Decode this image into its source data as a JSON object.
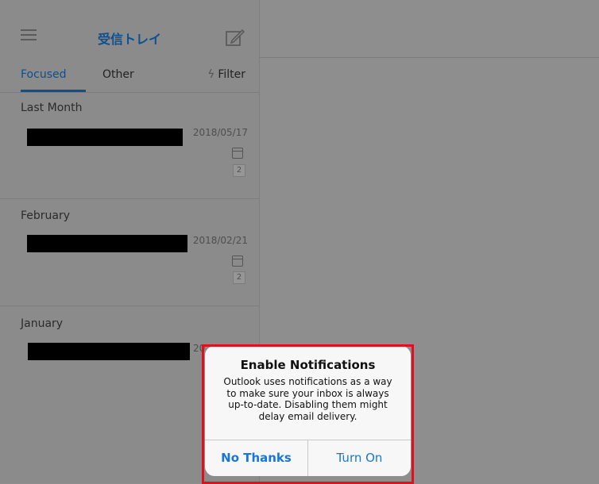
{
  "header": {
    "title": "受信トレイ",
    "menu_icon": "hamburger-menu-icon",
    "compose_icon": "compose-icon"
  },
  "tabs": {
    "focused": "Focused",
    "other": "Other",
    "filter": "Filter",
    "filter_icon": "lightning-bolt-icon"
  },
  "sections": [
    {
      "label": "Last Month",
      "date": "2018/05/17",
      "count": "2"
    },
    {
      "label": "February",
      "date": "2018/02/21",
      "count": "2"
    },
    {
      "label": "January",
      "date": "20"
    }
  ],
  "dialog": {
    "title": "Enable Notifications",
    "message": "Outlook uses notifications as a way to make sure your inbox is always up-to-date. Disabling them might delay email delivery.",
    "no_thanks": "No Thanks",
    "turn_on": "Turn On"
  },
  "colors": {
    "accent": "#0e4f8f",
    "dialog_button": "#1877d6",
    "highlight_outline": "#e0111e"
  }
}
